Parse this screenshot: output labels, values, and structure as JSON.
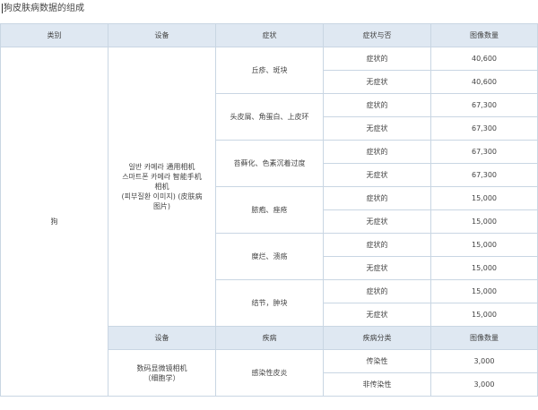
{
  "caption": "狗皮肤病数据的组成",
  "headers": [
    "类别",
    "设备",
    "症状",
    "症状与否",
    "图像数量"
  ],
  "category": "狗",
  "device1": [
    "일반 카메라 通用相机",
    "스마트폰 카메라 智能手机",
    "相机",
    "(피부질환 이미지) (皮肤病",
    "图片)"
  ],
  "symptoms": [
    {
      "name": "丘疹、斑块",
      "rows": [
        {
          "status": "症状的",
          "count": "40,600"
        },
        {
          "status": "无症状",
          "count": "40,600"
        }
      ]
    },
    {
      "name": "头皮屑、角蛋白、上皮环",
      "rows": [
        {
          "status": "症状的",
          "count": "67,300"
        },
        {
          "status": "无症状",
          "count": "67,300"
        }
      ]
    },
    {
      "name": "苔藓化、色素沉着过度",
      "rows": [
        {
          "status": "症状的",
          "count": "67,300"
        },
        {
          "status": "无症状",
          "count": "67,300"
        }
      ]
    },
    {
      "name": "脓疱、痤疮",
      "rows": [
        {
          "status": "症状的",
          "count": "15,000"
        },
        {
          "status": "无症状",
          "count": "15,000"
        }
      ]
    },
    {
      "name": "糜烂、溃疡",
      "rows": [
        {
          "status": "症状的",
          "count": "15,000"
        },
        {
          "status": "无症状",
          "count": "15,000"
        }
      ]
    },
    {
      "name": "结节，肿块",
      "rows": [
        {
          "status": "症状的",
          "count": "15,000"
        },
        {
          "status": "无症状",
          "count": "15,000"
        }
      ]
    }
  ],
  "sub_headers": [
    "设备",
    "疾病",
    "疾病分类",
    "图像数量"
  ],
  "device2": [
    "数码显微镜相机",
    "（细胞学）"
  ],
  "disease": "感染性皮炎",
  "disease_rows": [
    {
      "type": "传染性",
      "count": "3,000"
    },
    {
      "type": "非传染性",
      "count": "3,000"
    }
  ]
}
